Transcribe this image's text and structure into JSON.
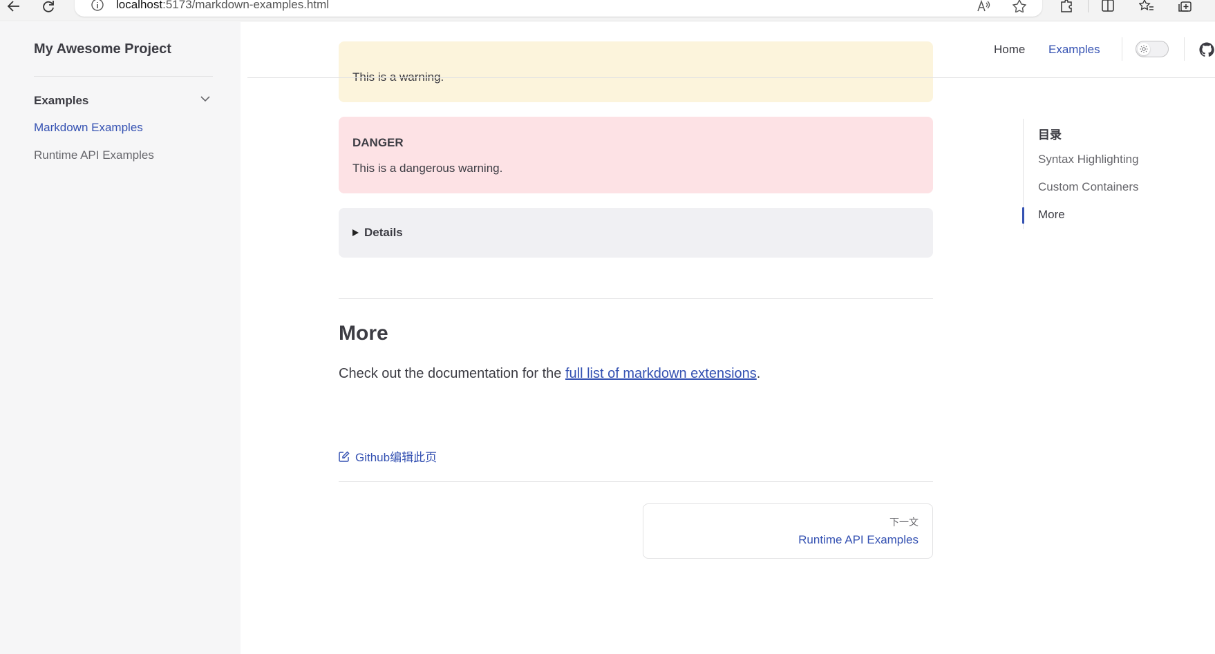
{
  "browser": {
    "url_host": "localhost",
    "url_path": ":5173/markdown-examples.html"
  },
  "sidebar": {
    "site_title": "My Awesome Project",
    "group_title": "Examples",
    "items": [
      {
        "label": "Markdown Examples",
        "active": true
      },
      {
        "label": "Runtime API Examples",
        "active": false
      }
    ]
  },
  "nav": {
    "home": "Home",
    "examples": "Examples"
  },
  "content": {
    "warning_text": "This is a warning.",
    "danger_title": "DANGER",
    "danger_text": "This is a dangerous warning.",
    "details_summary": "Details",
    "more_heading": "More",
    "more_text_before": "Check out the documentation for the ",
    "more_link": "full list of markdown extensions",
    "more_text_after": ".",
    "edit_link": "Github编辑此页",
    "next_desc": "下一文",
    "next_title": "Runtime API Examples"
  },
  "outline": {
    "title": "目录",
    "items": [
      "Syntax Highlighting",
      "Custom Containers",
      "More"
    ],
    "active_index": 2
  },
  "colors": {
    "brand": "#3451b2",
    "warning_bg": "#fcf4dc",
    "danger_bg": "#fde2e5",
    "details_bg": "#f0f0f3",
    "sidebar_bg": "#f6f6f7"
  }
}
